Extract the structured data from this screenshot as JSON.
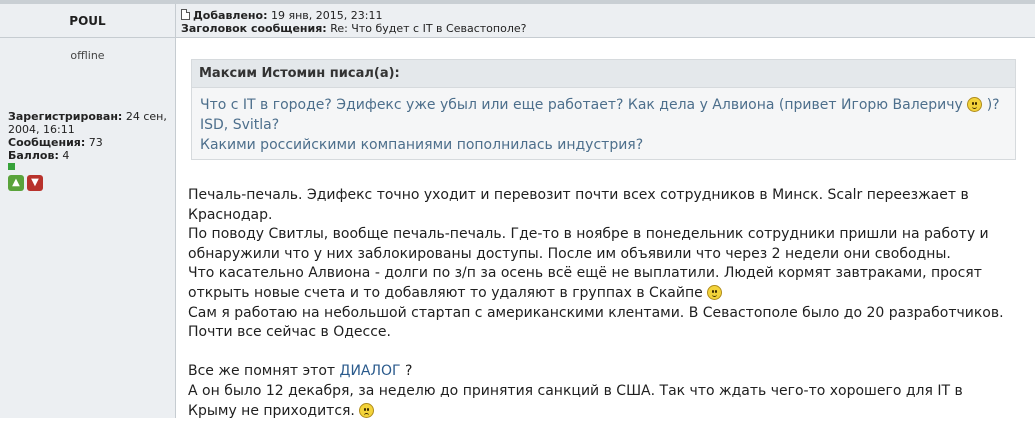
{
  "author": {
    "name": "POUL",
    "status": "offline",
    "registered_label": "Зарегистрирован:",
    "registered_value": "24 сен, 2004, 16:11",
    "messages_label": "Сообщения:",
    "messages_value": "73",
    "points_label": "Баллов:",
    "points_value": "4"
  },
  "post": {
    "added_label": "Добавлено:",
    "added_value": "19 янв, 2015, 23:11",
    "subject_label": "Заголовок сообщения:",
    "subject_value": "Re: Что будет с IT в Севастополе?"
  },
  "quote": {
    "author": "Максим Истомин писал(а):",
    "line1a": "Что с IT в городе? Эдифекс уже убыл или еще работает? Как дела у Алвиона (привет Игорю Валеричу",
    "line1b": ")?",
    "line2": "ISD, Svitla?",
    "line3": "Какими российскими компаниями пополнилась индустрия?"
  },
  "message": {
    "l1": "Печаль-печаль. Эдифекс точно уходит и перевозит почти всех сотрудников в Минск. Scalr переезжает в",
    "l2": "Краснодар.",
    "l3": "По поводу Свитлы, вообще печаль-печаль. Где-то в ноябре в понедельник сотрудники пришли на работу и",
    "l4": "обнаружили что у них заблокированы доступы. После им объявили что через 2 недели они свободны.",
    "l5": "Что касательно Алвиона - долги по з/п за осень всё ещё не выплатили. Людей кормят завтраками, просят",
    "l6": "открыть новые счета и то добавляют то удаляют в группах в Скайпе",
    "l7": "Сам я работаю на небольшой стартап с американскими клентами. В Севастополе было до 20 разработчиков.",
    "l8": "Почти все сейчас в Одессе.",
    "l9a": "Все же помнят этот",
    "l9link": "ДИАЛОГ",
    "l9b": "?",
    "l10": "А он было 12 декабря, за неделю до принятия санкций в США. Так что ждать чего-то хорошего для IT в",
    "l11": "Крыму не приходится."
  },
  "icons": {
    "smile": "smiley-happy-icon",
    "sad": "smiley-sad-icon",
    "post": "document-icon",
    "up": "thumbs-up-icon",
    "down": "thumbs-down-icon",
    "online_dot": "status-dot-icon"
  },
  "colors": {
    "accent_link": "#2a5a8c",
    "quote_text": "#4d6f8c",
    "header_bg": "#eceff2"
  }
}
